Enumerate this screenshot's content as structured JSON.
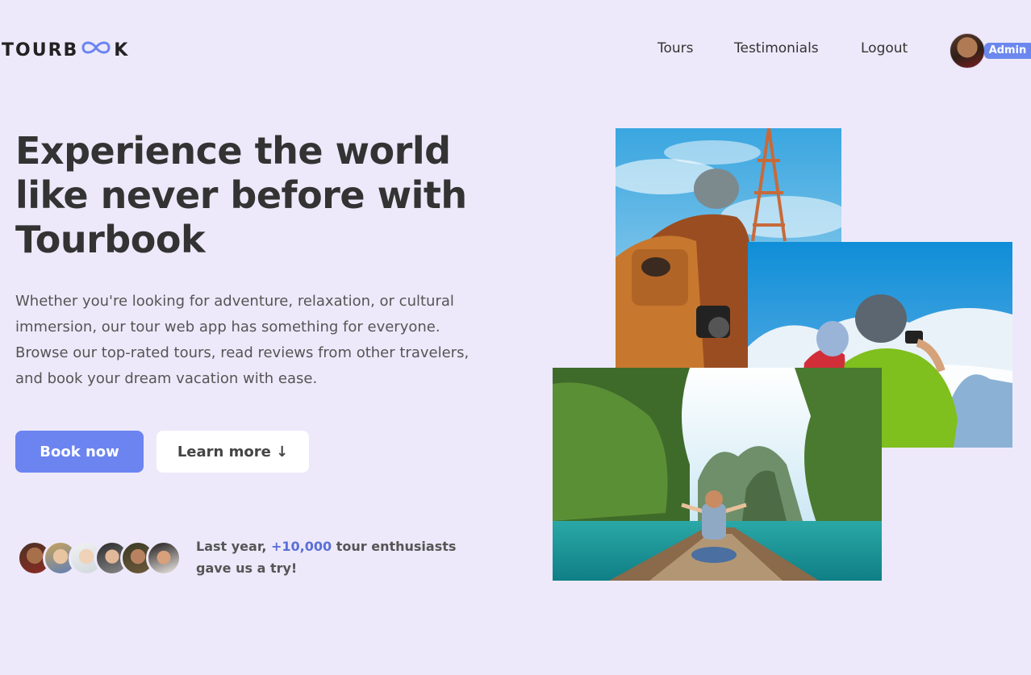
{
  "brand": {
    "name_left": "TOURB",
    "name_right": "K"
  },
  "nav": {
    "items": [
      "Tours",
      "Testimonials",
      "Logout"
    ]
  },
  "user": {
    "role_badge": "Admin"
  },
  "hero": {
    "headline": "Experience the world like never before with Tourbook",
    "description": "Whether you're looking for adventure, relaxation, or cultural immersion, our tour web app has something for everyone. Browse our top-rated tours, read reviews from other travelers, and book your dream vacation with ease.",
    "primary_cta": "Book now",
    "secondary_cta": "Learn more ↓"
  },
  "social_proof": {
    "prefix": "Last year, ",
    "count": "+10,000",
    "suffix": " tour enthusiasts gave us a try!"
  },
  "colors": {
    "background": "#ede9fa",
    "accent": "#6b84f0",
    "text": "#333333"
  }
}
